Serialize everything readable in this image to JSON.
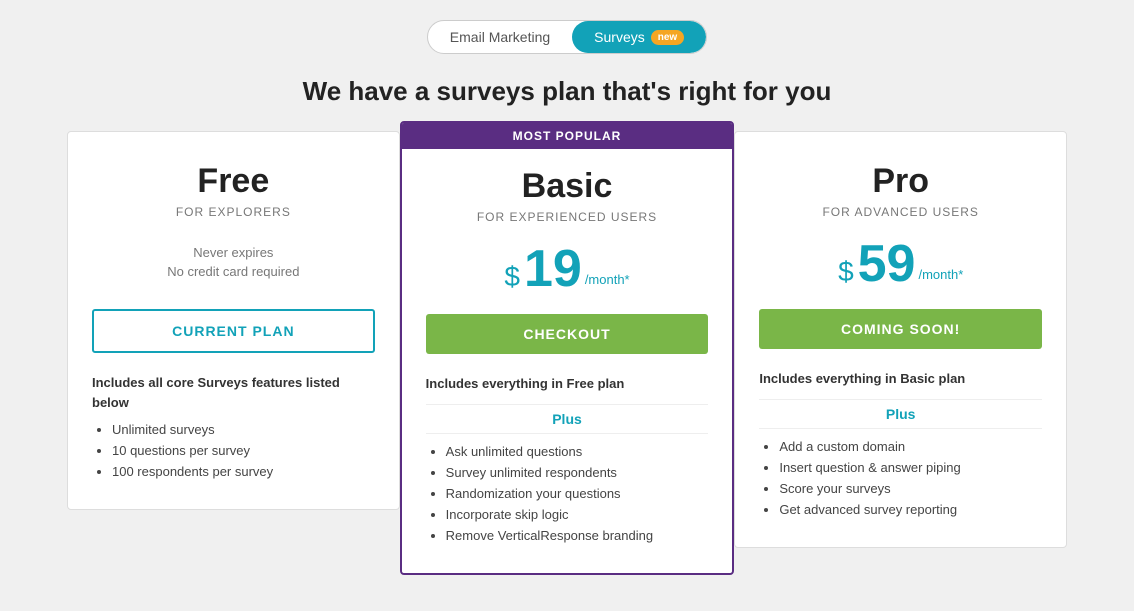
{
  "tabs": {
    "email_marketing": "Email Marketing",
    "surveys": "Surveys",
    "surveys_badge": "new"
  },
  "headline": "We have a surveys plan that's right for you",
  "plans": [
    {
      "id": "free",
      "title": "Free",
      "subtitle": "FOR EXPLORERS",
      "featured": false,
      "price_display": null,
      "never_expires_line1": "Never expires",
      "never_expires_line2": "No credit card required",
      "cta_label": "CURRENT PLAN",
      "cta_type": "current",
      "features_intro": "Includes all core Surveys features listed below",
      "features": [
        "Unlimited surveys",
        "10 questions per survey",
        "100 respondents per survey"
      ],
      "plus_label": null,
      "plus_features": []
    },
    {
      "id": "basic",
      "title": "Basic",
      "subtitle": "FOR EXPERIENCED USERS",
      "featured": true,
      "most_popular_label": "MOST POPULAR",
      "price_symbol": "$",
      "price_amount": "19",
      "price_per_month": "/month*",
      "cta_label": "CHECKOUT",
      "cta_type": "checkout",
      "features_intro": "Includes everything in Free plan",
      "features": [],
      "plus_label": "Plus",
      "plus_features": [
        "Ask unlimited questions",
        "Survey unlimited respondents",
        "Randomization your questions",
        "Incorporate skip logic",
        "Remove VerticalResponse branding"
      ]
    },
    {
      "id": "pro",
      "title": "Pro",
      "subtitle": "FOR ADVANCED USERS",
      "featured": false,
      "price_symbol": "$",
      "price_amount": "59",
      "price_per_month": "/month*",
      "cta_label": "COMING SOON!",
      "cta_type": "coming-soon",
      "features_intro": "Includes everything in Basic plan",
      "features": [],
      "plus_label": "Plus",
      "plus_features": [
        "Add a custom domain",
        "Insert question & answer piping",
        "Score your surveys",
        "Get advanced survey reporting"
      ]
    }
  ]
}
